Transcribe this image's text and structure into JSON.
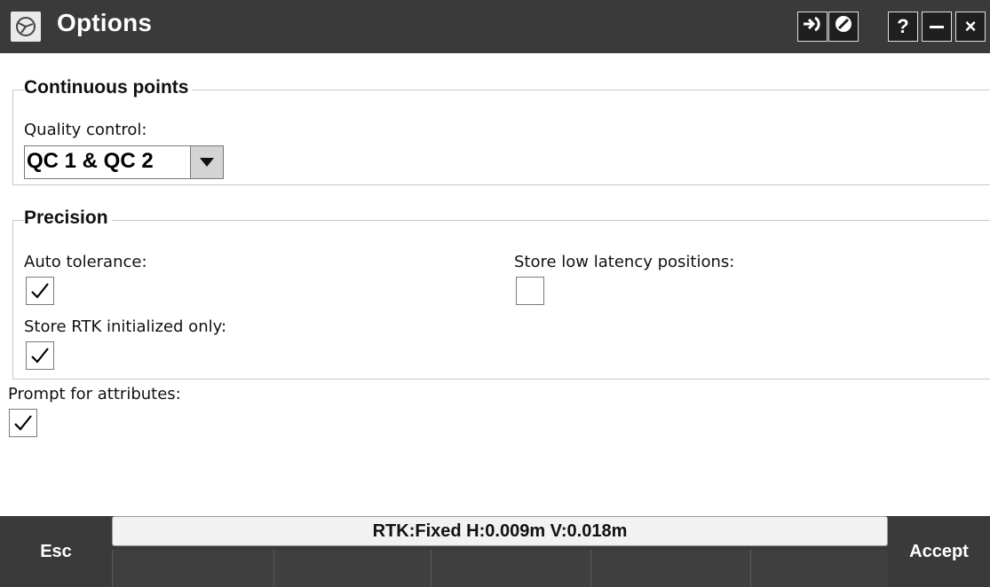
{
  "window": {
    "title": "Options",
    "buttons": [
      {
        "icon": "login-arrow-icon"
      },
      {
        "icon": "no-entry-icon"
      },
      {
        "label": "?"
      },
      {
        "icon": "minimize-icon"
      },
      {
        "label": "×"
      }
    ]
  },
  "continuous_points": {
    "legend": "Continuous points",
    "quality_control_label": "Quality control:",
    "quality_control_value": "QC 1 & QC 2"
  },
  "precision": {
    "legend": "Precision",
    "auto_tolerance_label": "Auto tolerance:",
    "auto_tolerance_checked": true,
    "store_low_latency_label": "Store low latency positions:",
    "store_low_latency_checked": false,
    "store_rtk_label": "Store RTK initialized only:",
    "store_rtk_checked": true
  },
  "prompt_attributes": {
    "label": "Prompt for attributes:",
    "checked": true
  },
  "footer": {
    "esc_label": "Esc",
    "accept_label": "Accept",
    "status_text": "RTK:Fixed H:0.009m V:0.018m"
  },
  "colors": {
    "titlebar_bg": "#3a3a3a",
    "button_bg": "#1f1f1f",
    "status_bg": "#f2f2f2"
  }
}
